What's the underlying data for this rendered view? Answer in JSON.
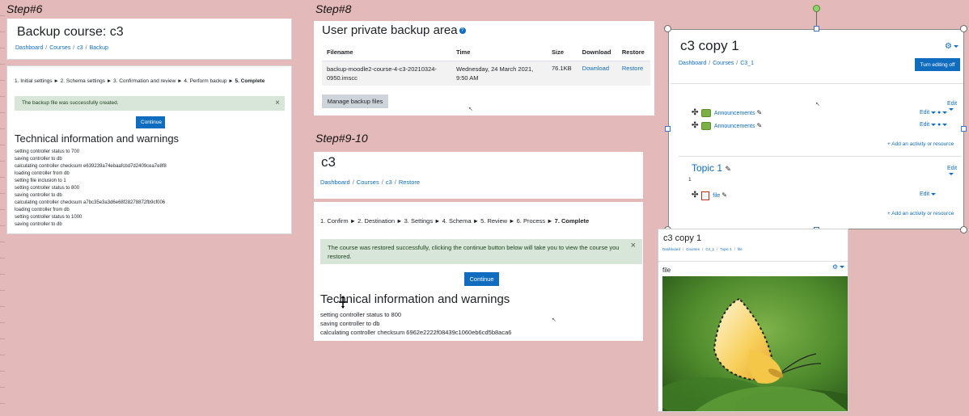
{
  "steps": {
    "step6": "Step#6",
    "step8": "Step#8",
    "step910": "Step#9-10"
  },
  "backup": {
    "title": "Backup course: c3",
    "breadcrumb": [
      "Dashboard",
      "Courses",
      "c3",
      "Backup"
    ],
    "stages": "1. Initial settings ► 2. Schema settings ► 3. Confirmation and review ► 4. Perform backup ► ",
    "stage_current": "5. Complete",
    "alert": "The backup file was successfully created.",
    "close": "×",
    "continue": "Continue",
    "tech_heading": "Technical information and warnings",
    "log": [
      "setting controller status to 700",
      "saving controller to db",
      "calculating controller checksum e639239a74ebaafcbd7d2409cea7e8f8",
      "loading controller from db",
      "setting file inclusion to 1",
      "setting controller status to 800",
      "saving controller to db",
      "calculating controller checksum a7bc35e3a3d6e68f28278872fb9cf006",
      "loading controller from db",
      "setting controller status to 1000",
      "saving controller to db"
    ]
  },
  "private_area": {
    "title": "User private backup area",
    "help_icon": "?",
    "headers": [
      "Filename",
      "Time",
      "Size",
      "Download",
      "Restore"
    ],
    "row": {
      "filename": "backup-moodle2-course-4-c3-20210324-0950.imscc",
      "time": "Wednesday, 24 March 2021, 9:50 AM",
      "size": "76.1KB",
      "download": "Download",
      "restore": "Restore"
    },
    "manage": "Manage backup files"
  },
  "restore": {
    "title": "c3",
    "breadcrumb": [
      "Dashboard",
      "Courses",
      "c3",
      "Restore"
    ],
    "stages": "1. Confirm ► 2. Destination ► 3. Settings ► 4. Schema ► 5. Review ► 6. Process ► ",
    "stage_current": "7. Complete",
    "alert": "The course was restored successfully, clicking the continue button below will take you to view the course you restored.",
    "close": "×",
    "continue": "Continue",
    "tech_heading": "Technical information and warnings",
    "log": [
      "setting controller status to 800",
      "saving controller to db",
      "calculating controller checksum 6962e2222f08439c1060eb6cd5b8aca6"
    ]
  },
  "copy": {
    "title": "c3 copy 1",
    "breadcrumb": [
      "Dashboard",
      "Courses",
      "C3_1"
    ],
    "turn_editing": "Turn editing off",
    "edit": "Edit",
    "modules_top": [
      "Announcements",
      "Announcements"
    ],
    "add_activity": "Add an activity or resource",
    "topic": "Topic 1",
    "topic_count": "1",
    "file_module": "file",
    "add_activity2": "Add an activity or resource"
  },
  "file_view": {
    "title": "c3 copy 1",
    "breadcrumb": [
      "Dashboard",
      "Courses",
      "C3_1",
      "Topic 1",
      "file"
    ],
    "label": "file"
  },
  "colors": {
    "accent": "#0f6cbf",
    "background": "#e4b9b9",
    "alert_bg": "#d7e6d8"
  }
}
